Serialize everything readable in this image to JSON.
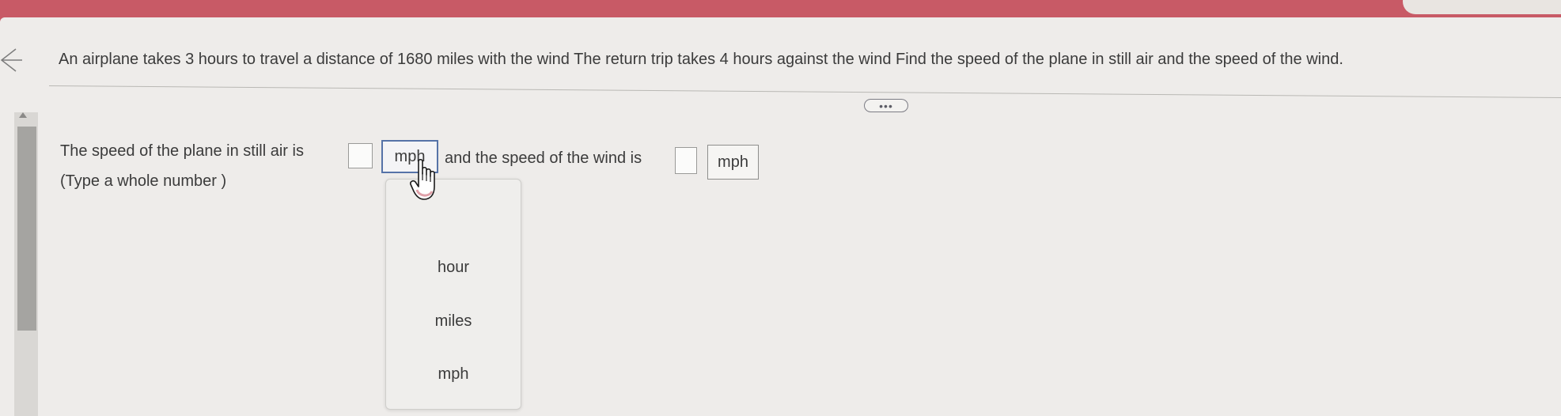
{
  "question": {
    "text": "An airplane takes 3 hours to travel a distance of 1680 miles with the wind  The return trip takes 4 hours against the wind  Find the speed of the plane in still air and the speed of the wind."
  },
  "toolbar": {
    "more_label": "•••"
  },
  "answer": {
    "prefix": "The speed of the plane in still air is",
    "plane_speed_value": "",
    "plane_unit": "mph",
    "middle": "and the speed of the wind is",
    "wind_speed_value": "",
    "wind_unit": "mph",
    "hint": "(Type a whole number )"
  },
  "dropdown": {
    "options": [
      "hour",
      "miles",
      "mph"
    ]
  },
  "icons": {
    "back": "back-arrow-icon",
    "cursor": "hand-pointer-icon",
    "scroll_up": "scroll-up-arrow-icon"
  },
  "colors": {
    "header_bar": "#c85a66",
    "active_border": "#5673a8",
    "page_background": "#eeecea"
  }
}
